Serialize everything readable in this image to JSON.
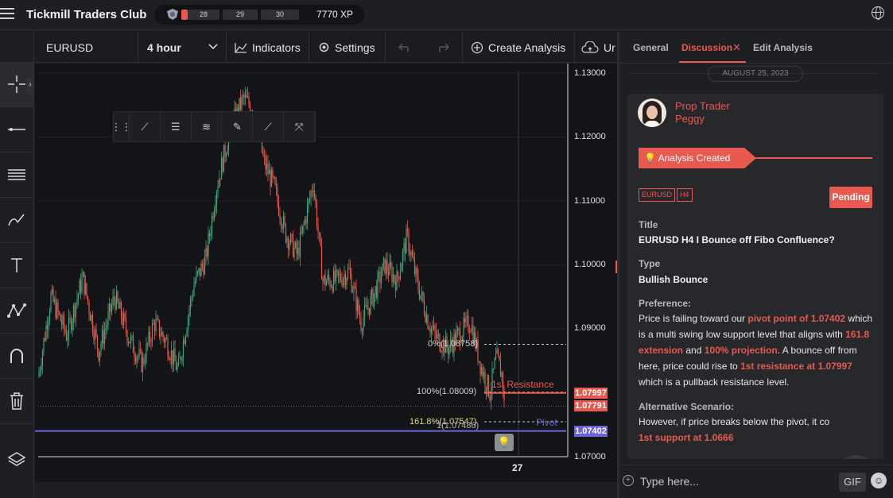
{
  "app": {
    "title": "Tickmill Traders Club"
  },
  "xp": {
    "levels": [
      "28",
      "29",
      "30"
    ],
    "value": "7770 XP",
    "progress": 0.12
  },
  "toolbar": {
    "symbol": "EURUSD",
    "interval": "4 hour",
    "indicators": "Indicators",
    "settings": "Settings",
    "create_analysis": "Create Analysis",
    "upload": "Ur"
  },
  "left_tools": [
    "crosshair-icon",
    "horizontal-line-icon",
    "fib-lines-icon",
    "brush-icon",
    "text-icon",
    "pattern-icon",
    "magnet-icon",
    "trash-icon",
    "layers-icon"
  ],
  "chart": {
    "price_axis": [
      "1.13000",
      "1.12000",
      "1.11000",
      "1.10000",
      "1.09000",
      "1.07000"
    ],
    "price_tags": {
      "resistance": "1.07997",
      "current": "1.07791",
      "pivot": "1.07402"
    },
    "fib_labels": {
      "zero": "0%(1.08758)",
      "hundred": "100%(1.08009)",
      "ext": "161.8%(1.07547)",
      "one": "1(1.07486)"
    },
    "annotations": {
      "resistance": "1st Resistance",
      "pivot": "Pivot"
    },
    "date_label": "27",
    "colors": {
      "up": "#3fa77f",
      "down": "#e85a4f",
      "pivot": "#6b63d9"
    }
  },
  "panel": {
    "tabs": {
      "general": "General",
      "discussion": "Discussion",
      "edit": "Edit Analysis"
    },
    "date": "AUGUST 25, 2023",
    "author": {
      "role": "Prop Trader",
      "name": "Peggy"
    },
    "banner": "Analysis Created",
    "tags": [
      "EURUSD",
      "H4"
    ],
    "status": "Pending",
    "title_label": "Title",
    "title_value": "EURUSD H4 I Bounce off Fibo Confluence?",
    "type_label": "Type",
    "type_value": "Bullish Bounce",
    "pref_label": "Preference:",
    "pref_text": {
      "p1": "Price is failing toward our ",
      "h1": "pivot point of 1.07402",
      "p2": " which is a multi swing low support level that aligns with ",
      "h2": "161.8 extension",
      "p3": " and ",
      "h3": "100% projection",
      "p4": ". A bounce off from here, price could rise to ",
      "h4": "1st resistance at 1.07997",
      "p5": " which is a pullback resistance level."
    },
    "alt_label": "Alternative Scenario:",
    "alt_text": "However, if price breaks below the pivot, it co",
    "alt_highlight": "1st support at 1.0666"
  },
  "composer": {
    "placeholder": "Type here...",
    "gif": "GIF"
  }
}
